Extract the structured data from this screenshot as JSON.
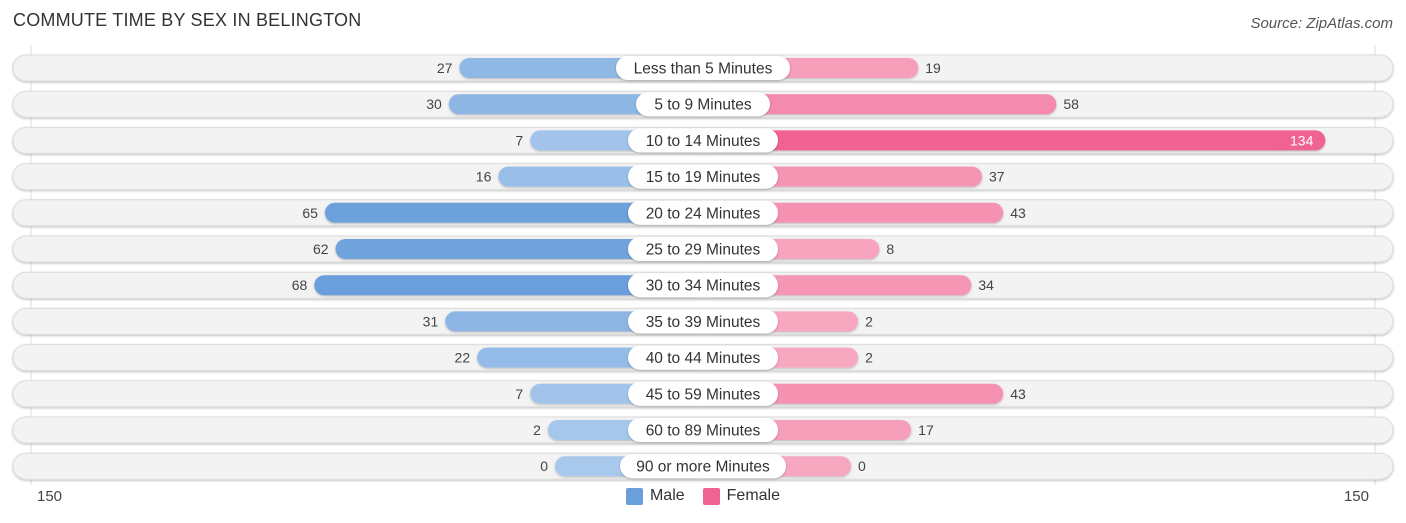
{
  "title": "COMMUTE TIME BY SEX IN BELINGTON",
  "source": "Source: ZipAtlas.com",
  "colors": {
    "male": "#6a9fdb",
    "male_light": "#a8c8ec",
    "female": "#f06292",
    "female_light": "#f7a8c1",
    "track": "#f3f3f3"
  },
  "legend": [
    {
      "label": "Male",
      "color": "#6a9fdb"
    },
    {
      "label": "Female",
      "color": "#f06292"
    }
  ],
  "axis": {
    "left_label": "150",
    "right_label": "150"
  },
  "chart_data": {
    "type": "bar",
    "orientation": "horizontal-diverging",
    "title": "COMMUTE TIME BY SEX IN BELINGTON",
    "categories": [
      "Less than 5 Minutes",
      "5 to 9 Minutes",
      "10 to 14 Minutes",
      "15 to 19 Minutes",
      "20 to 24 Minutes",
      "25 to 29 Minutes",
      "30 to 34 Minutes",
      "35 to 39 Minutes",
      "40 to 44 Minutes",
      "45 to 59 Minutes",
      "60 to 89 Minutes",
      "90 or more Minutes"
    ],
    "series": [
      {
        "name": "Male",
        "values": [
          27,
          30,
          7,
          16,
          65,
          62,
          68,
          31,
          22,
          7,
          2,
          0
        ]
      },
      {
        "name": "Female",
        "values": [
          19,
          58,
          134,
          37,
          43,
          8,
          34,
          2,
          2,
          43,
          17,
          0
        ]
      }
    ],
    "xlim": [
      -150,
      150
    ],
    "xlabel": "",
    "ylabel": "",
    "legend_position": "bottom-center"
  }
}
